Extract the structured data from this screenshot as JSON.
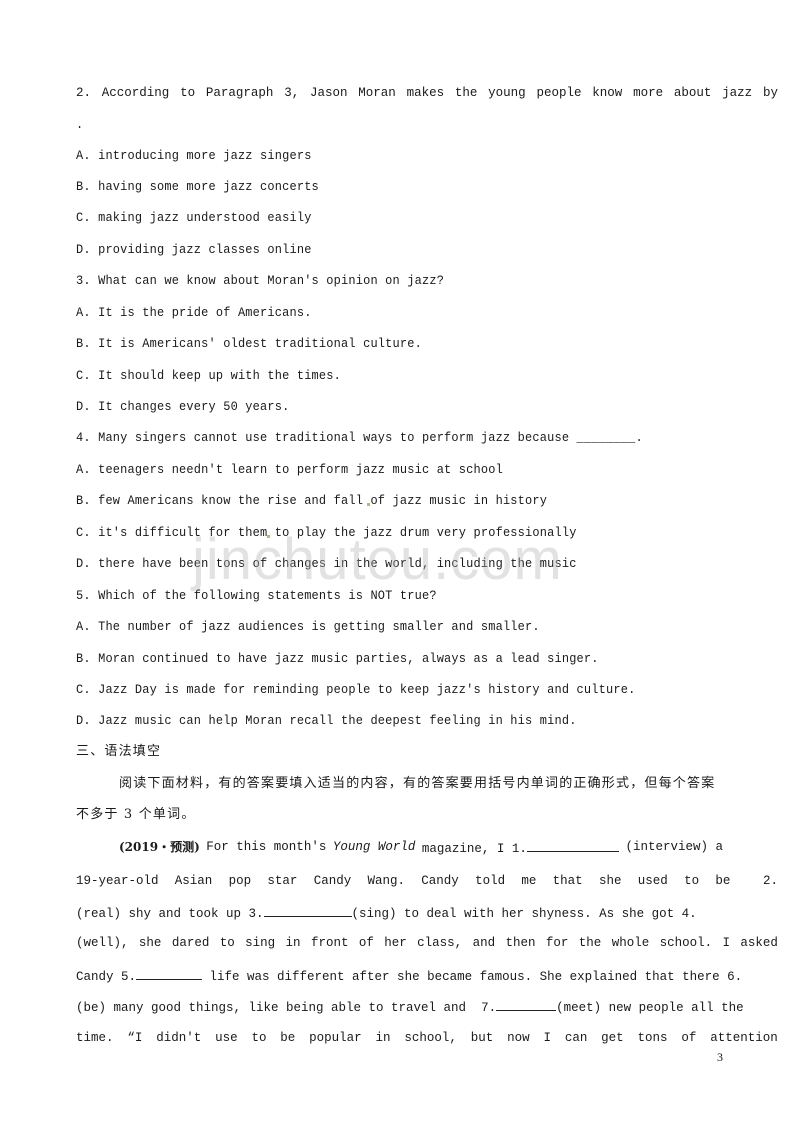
{
  "questions": [
    {
      "stem": "2. According to Paragraph 3, Jason Moran makes the young people know more about jazz by",
      "stem_cont": ".",
      "options": [
        "A. introducing more jazz singers",
        "B. having some more jazz concerts",
        "C. making jazz understood easily",
        "D. providing jazz classes online"
      ]
    },
    {
      "stem": "3. What can we know about Moran's opinion on jazz?",
      "options": [
        "A. It is the pride of Americans.",
        "B. It is Americans' oldest traditional culture.",
        "C. It should keep up with the times.",
        "D. It changes every 50 years."
      ]
    },
    {
      "stem": "4. Many singers cannot use traditional ways to perform jazz because ________.",
      "options": [
        "A. teenagers needn't learn to perform jazz music at school",
        "B. few Americans know the rise and fall of jazz music in history",
        "C. it's difficult for them to play the jazz drum very professionally",
        "D. there have been tons of changes in the world, including the music"
      ]
    },
    {
      "stem": "5. Which of the following statements is NOT true?",
      "options": [
        "A. The number of jazz audiences is getting smaller and smaller.",
        "B. Moran continued to have jazz music parties, always as a lead singer.",
        "C. Jazz Day is made for reminding people to keep jazz's history and culture.",
        "D. Jazz music can help Moran recall the deepest feeling in his mind."
      ]
    }
  ],
  "section3": {
    "heading": "三、语法填空",
    "instruction_line1": "阅读下面材料，有的答案要填入适当的内容，有的答案要用括号内单词的正确形式，但每个答案",
    "instruction_line2": "不多于 3 个单词。",
    "source_tag": "(2019・预测)",
    "passage": {
      "l1_a": "For this month's",
      "l1_italic": "Young World",
      "l1_b": "magazine, I 1.",
      "l1_c": "(interview) a",
      "l2": [
        "19-year-old",
        "Asian",
        "pop",
        "star",
        "Candy",
        "Wang.",
        "Candy",
        "told",
        "me",
        "that",
        "she",
        "used",
        "to",
        "be",
        "",
        "2."
      ],
      "l3_a": "(real) shy and took up 3.",
      "l3_b": "(sing) to deal with her shyness. As she got 4.",
      "l4": [
        "(well),",
        "she",
        "dared",
        "to",
        "sing",
        "in",
        "front",
        "of",
        "her",
        "class,",
        "and",
        "then",
        "for",
        "the",
        "whole",
        "school.",
        "I",
        "asked"
      ],
      "l5_a": "Candy 5.",
      "l5_b": "life was different after she became famous. She explained that there 6.",
      "l6_a": "(be) many good things, like being able to travel and  7.",
      "l6_b": "(meet) new people all the",
      "l7": [
        "time.",
        "“I",
        "didn't",
        "use",
        "to",
        "be",
        "popular",
        "in",
        "school,",
        "but",
        "now",
        "I",
        "can",
        "get",
        "tons",
        "of",
        "attention"
      ]
    }
  },
  "watermark": "jinchutou.com",
  "page_number": "3"
}
